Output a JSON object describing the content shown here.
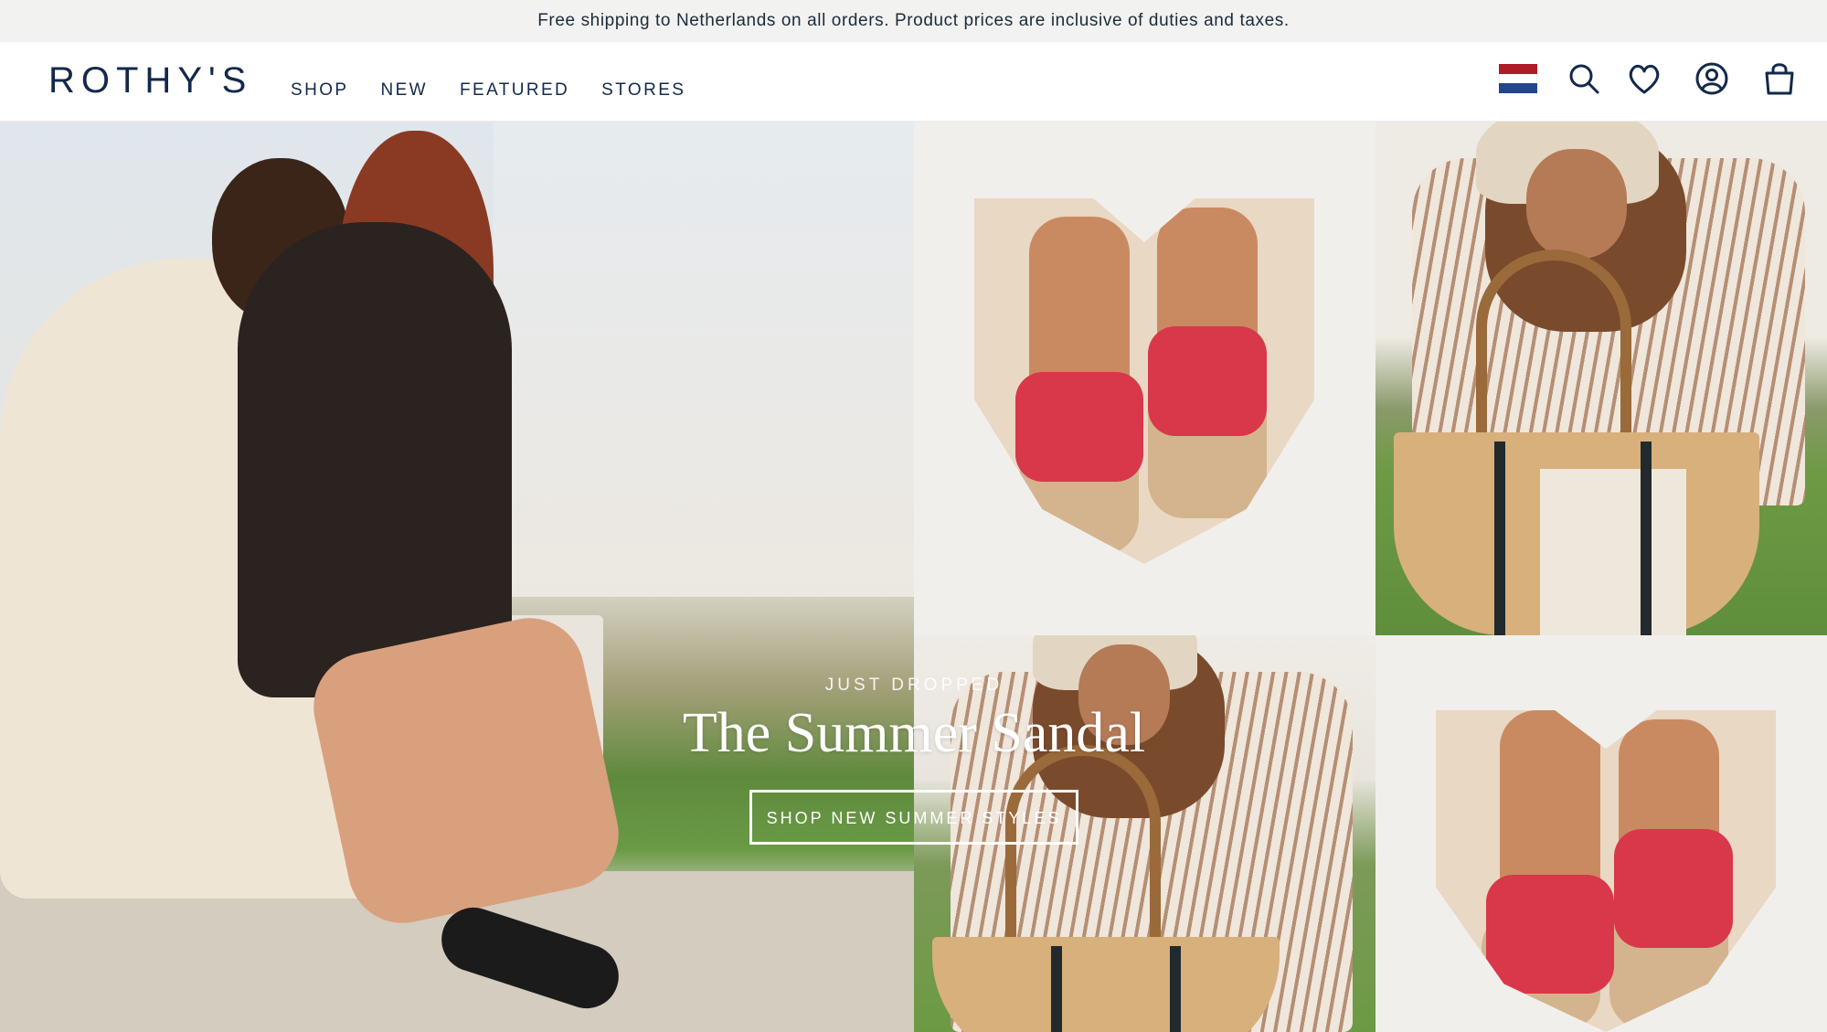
{
  "announcement": "Free shipping to Netherlands on all orders. Product prices are inclusive of duties and taxes.",
  "header": {
    "logo": "ROTHY'S",
    "nav": [
      "SHOP",
      "NEW",
      "FEATURED",
      "STORES"
    ],
    "icons": [
      "netherlands-flag-icon",
      "search-icon",
      "heart-icon",
      "account-icon",
      "bag-icon"
    ]
  },
  "hero": {
    "kicker": "JUST DROPPED",
    "headline": "The Summer Sandal",
    "cta": "SHOP NEW SUMMER STYLES"
  },
  "colors": {
    "brand_navy": "#13294b",
    "announcement_bg": "#f2f2f0",
    "flag_red": "#ae1c28",
    "flag_white": "#ffffff",
    "flag_blue": "#21468b",
    "sandal_red": "#d8384a"
  }
}
